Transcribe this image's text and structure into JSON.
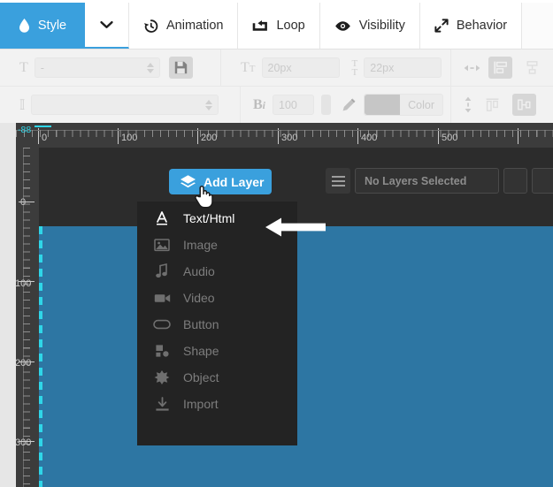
{
  "tabs": [
    {
      "label": "Style",
      "icon": "water-drop-icon",
      "active": true
    },
    {
      "label": "",
      "icon": "chevron-down-icon",
      "active": false
    },
    {
      "label": "Animation",
      "icon": "clock-rewind-icon",
      "active": false
    },
    {
      "label": "Loop",
      "icon": "loop-icon",
      "active": false
    },
    {
      "label": "Visibility",
      "icon": "eye-icon",
      "active": false
    },
    {
      "label": "Behavior",
      "icon": "expand-arrows-icon",
      "active": false
    }
  ],
  "toolbar": {
    "row1": {
      "font_family_icon": "text-T-icon",
      "font_family_value": "-",
      "save_button_icon": "floppy-save-icon",
      "font_size_icon": "font-size-icon",
      "font_size_value": "20px",
      "line_height_icon": "line-height-icon",
      "line_height_value": "22px",
      "horizontal_align_icon": "horizontal-arrows-icon",
      "align_left_icon": "align-left-icon",
      "align_center_icon": "align-center-icon"
    },
    "row2": {
      "text_transform_icon": "text-transform-icon",
      "text_transform_value": "",
      "bold_italic_icon": "bold-italic-icon",
      "opacity_value": "100",
      "pencil_icon": "pencil-icon",
      "color_label": "Color",
      "vertical_align_icon": "vertical-arrows-icon",
      "valign_top_icon": "align-top-icon",
      "valign_middle_icon": "align-middle-icon"
    }
  },
  "ruler": {
    "negative_offset_label": "-88",
    "horizontal_labels": [
      "0",
      "100",
      "200",
      "300",
      "400",
      "500"
    ],
    "vertical_labels": [
      "0",
      "100",
      "200",
      "300"
    ]
  },
  "stage": {
    "add_layer_button": {
      "label": "Add Layer",
      "icon": "layers-diamond-icon"
    },
    "layers_menu_icon": "hamburger-icon",
    "layers_select_value": "No Layers Selected",
    "cursor_icon": "pointing-hand-cursor",
    "canvas_color": "#2d76a3",
    "guide_color": "#2fd6e8"
  },
  "dropdown": {
    "items": [
      {
        "label": "Text/Html",
        "icon": "text-a-icon",
        "highlighted": true
      },
      {
        "label": "Image",
        "icon": "image-icon",
        "highlighted": false
      },
      {
        "label": "Audio",
        "icon": "music-note-icon",
        "highlighted": false
      },
      {
        "label": "Video",
        "icon": "video-camera-icon",
        "highlighted": false
      },
      {
        "label": "Button",
        "icon": "button-pill-icon",
        "highlighted": false
      },
      {
        "label": "Shape",
        "icon": "shape-icon",
        "highlighted": false
      },
      {
        "label": "Object",
        "icon": "puzzle-piece-icon",
        "highlighted": false
      },
      {
        "label": "Import",
        "icon": "download-import-icon",
        "highlighted": false
      }
    ]
  },
  "annotation": {
    "arrow_icon": "left-pointing-arrow",
    "color": "#ffffff"
  },
  "colors": {
    "accent_blue": "#3aa0dd",
    "canvas_blue": "#2d76a3",
    "guide_cyan": "#2fd6e8",
    "editor_bg": "#3a3a3a",
    "menu_bg": "#232323"
  }
}
